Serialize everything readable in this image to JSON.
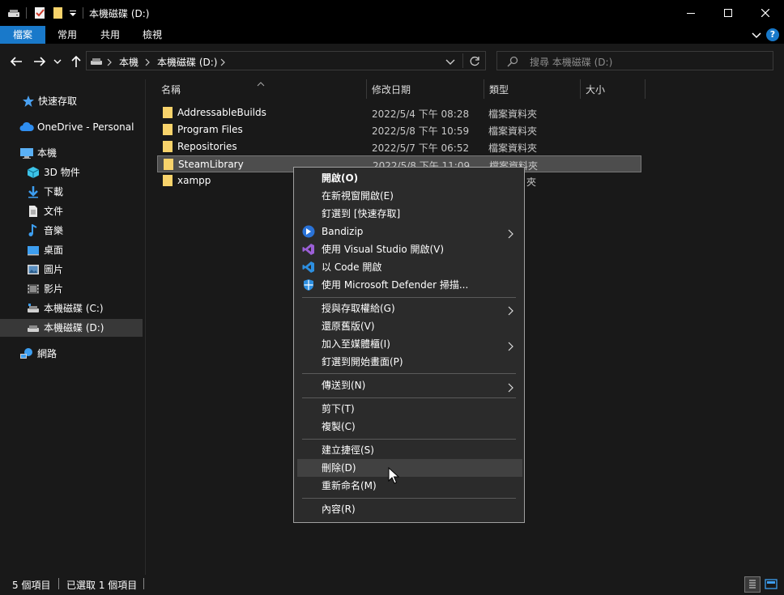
{
  "window": {
    "title": "本機磁碟 (D:)",
    "controls": [
      "minimize",
      "maximize",
      "close"
    ]
  },
  "ribbon": {
    "tabs": [
      {
        "label": "檔案",
        "active": true
      },
      {
        "label": "常用"
      },
      {
        "label": "共用"
      },
      {
        "label": "檢視"
      }
    ],
    "help_label": "?"
  },
  "address": {
    "crumbs": [
      "本機",
      "本機磁碟 (D:)"
    ],
    "search_placeholder": "搜尋 本機磁碟 (D:)"
  },
  "sidebar": {
    "items": [
      {
        "label": "快速存取",
        "icon": "star-icon"
      },
      {
        "label": "OneDrive - Personal",
        "icon": "cloud-icon"
      },
      {
        "label": "本機",
        "icon": "computer-icon"
      },
      {
        "label": "3D 物件",
        "icon": "cube-icon"
      },
      {
        "label": "下載",
        "icon": "download-icon"
      },
      {
        "label": "文件",
        "icon": "document-icon"
      },
      {
        "label": "音樂",
        "icon": "music-icon"
      },
      {
        "label": "桌面",
        "icon": "desktop-icon"
      },
      {
        "label": "圖片",
        "icon": "picture-icon"
      },
      {
        "label": "影片",
        "icon": "video-icon"
      },
      {
        "label": "本機磁碟 (C:)",
        "icon": "drive-icon"
      },
      {
        "label": "本機磁碟 (D:)",
        "icon": "drive-icon",
        "selected": true
      },
      {
        "label": "網路",
        "icon": "network-icon"
      }
    ]
  },
  "filelist": {
    "columns": [
      "名稱",
      "修改日期",
      "類型",
      "大小"
    ],
    "rows": [
      {
        "name": "AddressableBuilds",
        "date": "2022/5/4 下午 08:28",
        "type": "檔案資料夾"
      },
      {
        "name": "Program Files",
        "date": "2022/5/8 下午 10:59",
        "type": "檔案資料夾"
      },
      {
        "name": "Repositories",
        "date": "2022/5/7 下午 06:52",
        "type": "檔案資料夾"
      },
      {
        "name": "SteamLibrary",
        "date": "2022/5/8 下午 11:09",
        "type": "檔案資料夾",
        "selected": true
      },
      {
        "name": "xampp",
        "date": "",
        "type": "夾"
      }
    ]
  },
  "context_menu": {
    "items": [
      {
        "label": "開啟(O)",
        "bold": true
      },
      {
        "label": "在新視窗開啟(E)"
      },
      {
        "label": "釘選到 [快速存取]"
      },
      {
        "label": "Bandizip",
        "icon": "bandizip-icon",
        "submenu": true
      },
      {
        "label": "使用 Visual Studio 開啟(V)",
        "icon": "visual-studio-icon"
      },
      {
        "label": "以 Code 開啟",
        "icon": "vscode-icon"
      },
      {
        "label": "使用 Microsoft Defender 掃描...",
        "icon": "defender-shield-icon"
      },
      {
        "label": "授與存取權給(G)",
        "submenu": true
      },
      {
        "label": "還原舊版(V)"
      },
      {
        "label": "加入至媒體櫃(I)",
        "submenu": true
      },
      {
        "label": "釘選到開始畫面(P)"
      },
      {
        "label": "傳送到(N)",
        "submenu": true
      },
      {
        "label": "剪下(T)"
      },
      {
        "label": "複製(C)"
      },
      {
        "label": "建立捷徑(S)"
      },
      {
        "label": "刪除(D)",
        "hovered": true
      },
      {
        "label": "重新命名(M)"
      },
      {
        "label": "內容(R)"
      }
    ]
  },
  "status": {
    "count": "5 個項目",
    "selected": "已選取 1 個項目"
  },
  "colors": {
    "accent": "#1979ca",
    "folder": "#f8d36b",
    "background": "#191919"
  }
}
